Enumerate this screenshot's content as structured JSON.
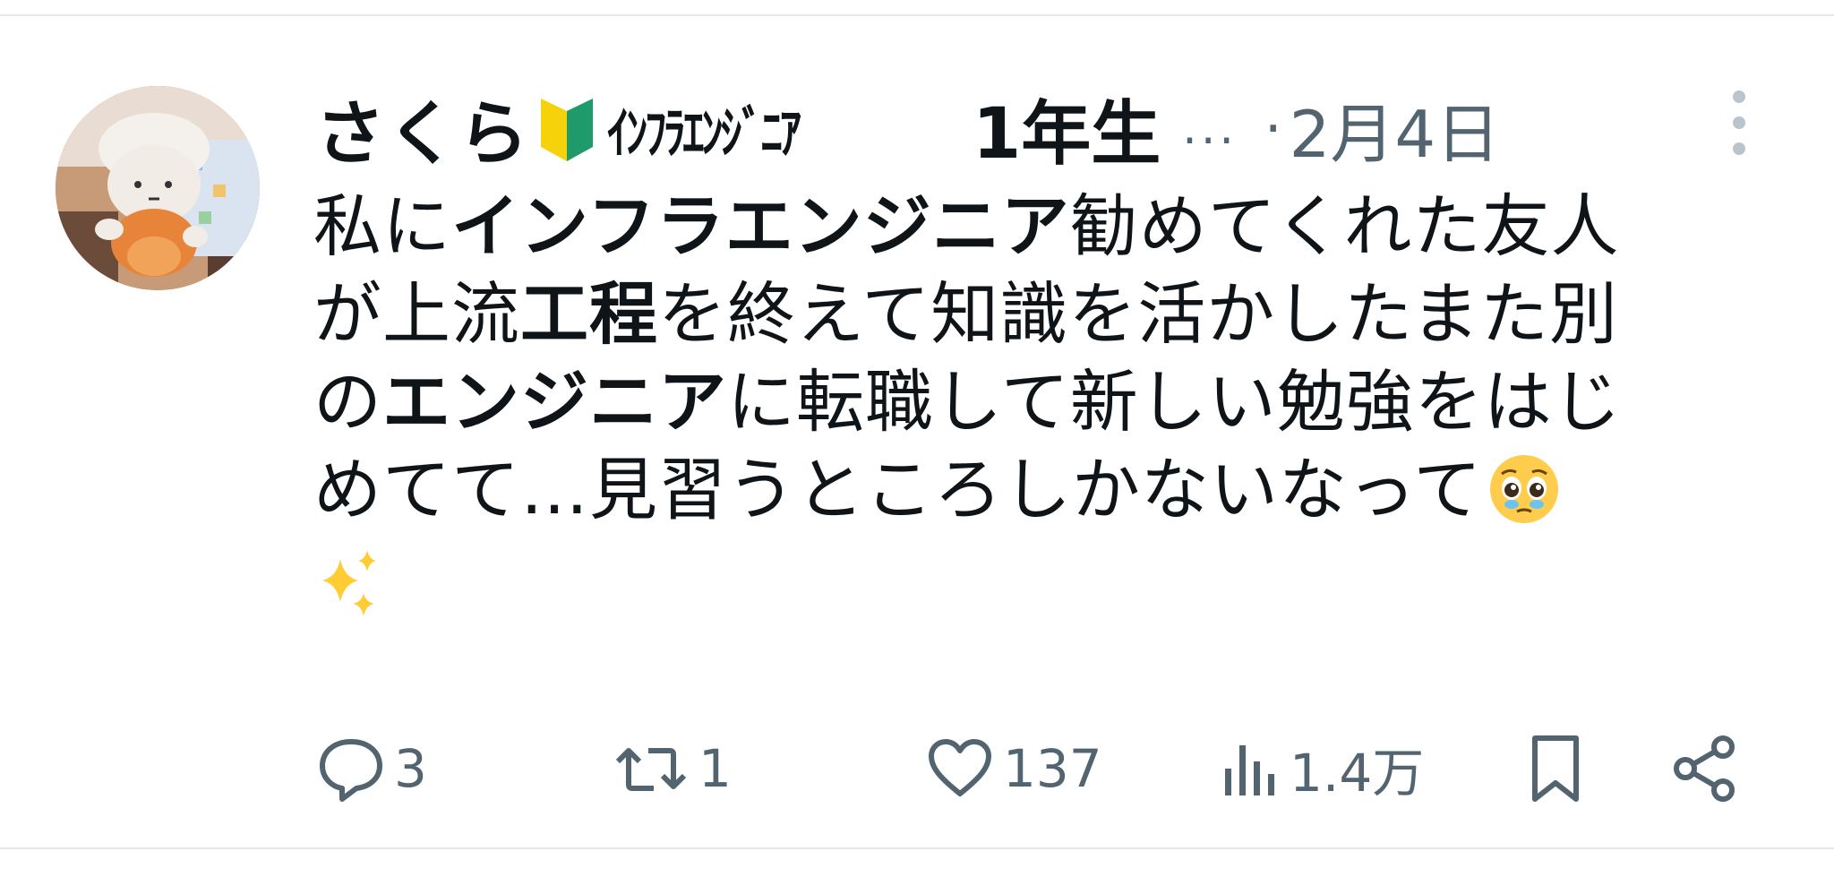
{
  "tweet": {
    "author": {
      "display_name": "さくら",
      "badge_icon": "beginner-leaf-icon",
      "name_suffix": "ｲﾝﾌﾗｴﾝｼﾞﾆｱ",
      "name_year": "1年生",
      "truncation": "...",
      "avatar_icon": "avatar-plush-toy"
    },
    "separator": "·",
    "date": "2月4日",
    "more_icon": "vertical-dots-icon",
    "body": {
      "line1": {
        "p1": "私に",
        "b1": "インフラエンジニア",
        "p2": "勧めてくれた友人"
      },
      "line2": {
        "p1": "が上流",
        "b1": "工程",
        "p2": "を終えて知識を活かしたまた別"
      },
      "line3": {
        "p1": "の",
        "b1": "エンジニア",
        "p2": "に転職して新しい勉強をはじ"
      },
      "line4": {
        "p1": "めてて…見習うところしかないなって"
      },
      "emoji_1": "pleading-face-emoji",
      "emoji_2": "sparkles-emoji"
    },
    "actions": {
      "reply": {
        "icon": "reply-icon",
        "count": "3"
      },
      "retweet": {
        "icon": "retweet-icon",
        "count": "1"
      },
      "like": {
        "icon": "heart-icon",
        "count": "137"
      },
      "views": {
        "icon": "bar-chart-icon",
        "count": "1.4万"
      },
      "bookmark": {
        "icon": "bookmark-icon"
      },
      "share": {
        "icon": "share-icon"
      }
    },
    "colors": {
      "text": "#0f1419",
      "muted": "#536471",
      "divider": "#e3e7ea"
    }
  }
}
